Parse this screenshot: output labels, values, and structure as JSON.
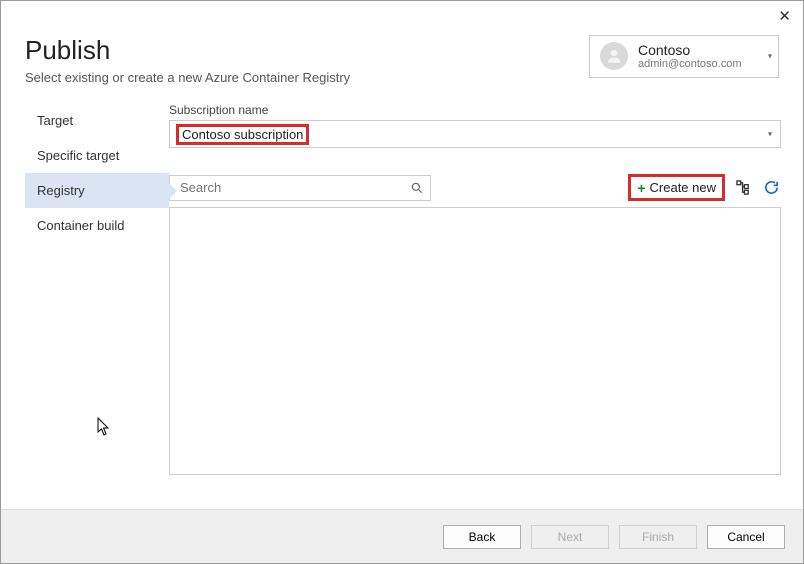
{
  "window": {
    "title": "Publish",
    "subtitle": "Select existing or create a new Azure Container Registry"
  },
  "account": {
    "name": "Contoso",
    "email": "admin@contoso.com"
  },
  "sidebar": {
    "items": [
      {
        "label": "Target"
      },
      {
        "label": "Specific target"
      },
      {
        "label": "Registry"
      },
      {
        "label": "Container build"
      }
    ],
    "activeIndex": 2
  },
  "subscription": {
    "label": "Subscription name",
    "value": "Contoso subscription"
  },
  "search": {
    "placeholder": "Search"
  },
  "toolbar": {
    "create_new": "Create new"
  },
  "footer": {
    "back": "Back",
    "next": "Next",
    "finish": "Finish",
    "cancel": "Cancel"
  }
}
